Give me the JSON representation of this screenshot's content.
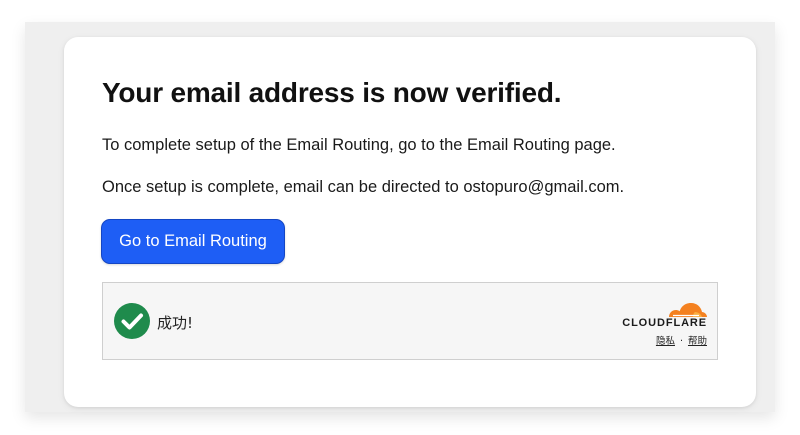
{
  "heading": "Your email address is now verified.",
  "instruction": "To complete setup of the Email Routing, go to the Email Routing page.",
  "destination_text": "Once setup is complete, email can be directed to ostopuro@gmail.com.",
  "primary_button": "Go to Email Routing",
  "captcha_widget": {
    "status_icon": "check-circle-icon",
    "status_text": "成功!",
    "brand_icon": "cloudflare-cloud-icon",
    "brand_word": "CLOUDFLARE",
    "privacy_link": "隐私",
    "separator": "·",
    "help_link": "帮助"
  },
  "colors": {
    "button_bg": "#1e5ef5",
    "success_green": "#1f8b4c",
    "cloudflare_orange": "#f48120",
    "cloudflare_orange_light": "#faae40"
  }
}
